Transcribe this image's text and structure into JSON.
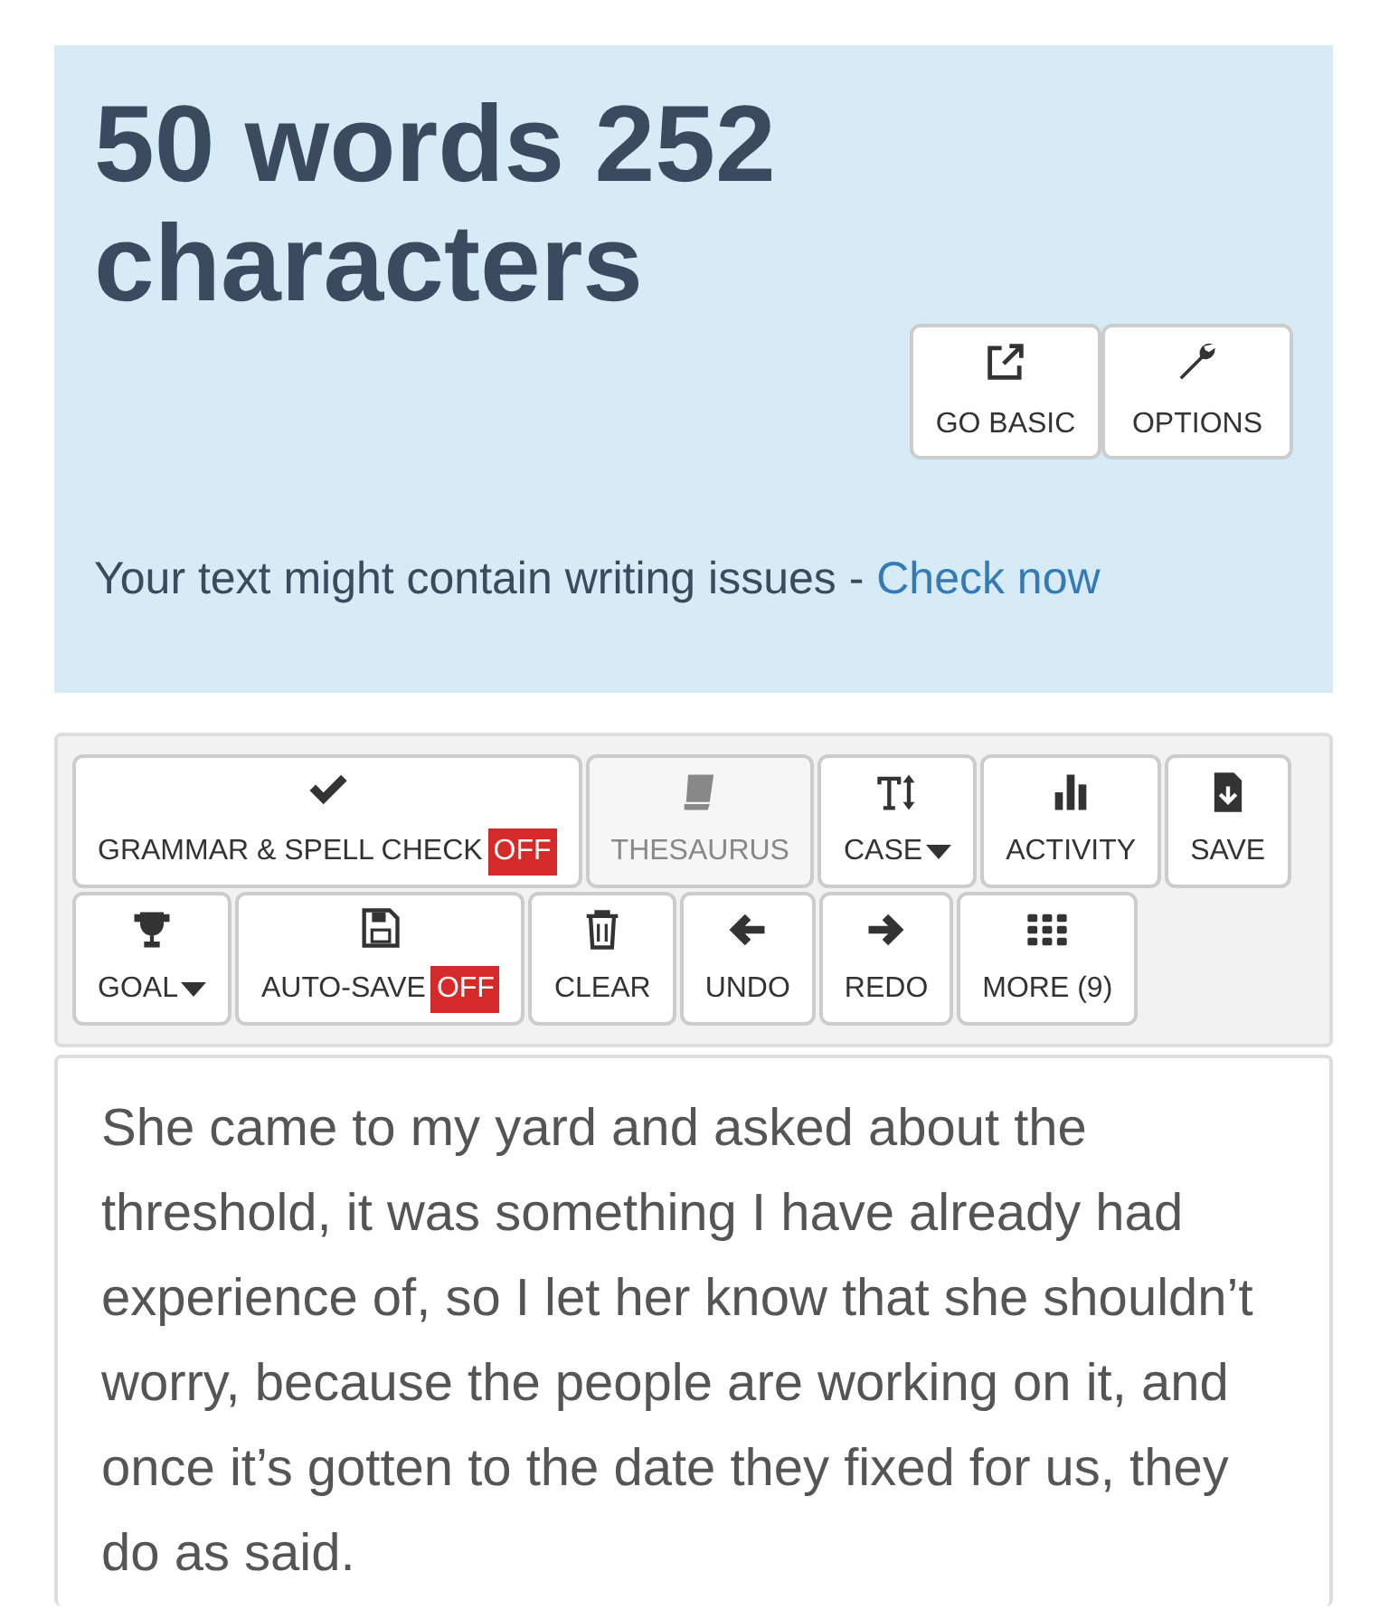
{
  "stats": {
    "headline": "50 words 252 characters"
  },
  "header_buttons": [
    {
      "label": "GO BASIC"
    },
    {
      "label": "OPTIONS"
    }
  ],
  "notice": {
    "text": "Your text might contain writing issues - ",
    "link": "Check now"
  },
  "toolbar": [
    {
      "label": "GRAMMAR & SPELL CHECK",
      "badge": "OFF",
      "disabled": false,
      "menu": false
    },
    {
      "label": "THESAURUS",
      "disabled": true,
      "menu": false
    },
    {
      "label": "CASE",
      "disabled": false,
      "menu": true
    },
    {
      "label": "ACTIVITY",
      "disabled": false,
      "menu": false
    },
    {
      "label": "SAVE",
      "disabled": false,
      "menu": false
    },
    {
      "label": "GOAL",
      "disabled": false,
      "menu": true
    },
    {
      "label": "AUTO-SAVE",
      "badge": "OFF",
      "disabled": false,
      "menu": false
    },
    {
      "label": "CLEAR",
      "disabled": false,
      "menu": false
    },
    {
      "label": "UNDO",
      "disabled": false,
      "menu": false
    },
    {
      "label": "REDO",
      "disabled": false,
      "menu": false
    },
    {
      "label": "MORE (9)",
      "disabled": false,
      "menu": false
    }
  ],
  "editor": {
    "value": "She came to my yard and asked about the threshold, it was something I have already had experience of, so I let her know that she shouldn’t worry, because the people are working on it, and once it’s gotten to the date they fixed for us, they do as said."
  }
}
